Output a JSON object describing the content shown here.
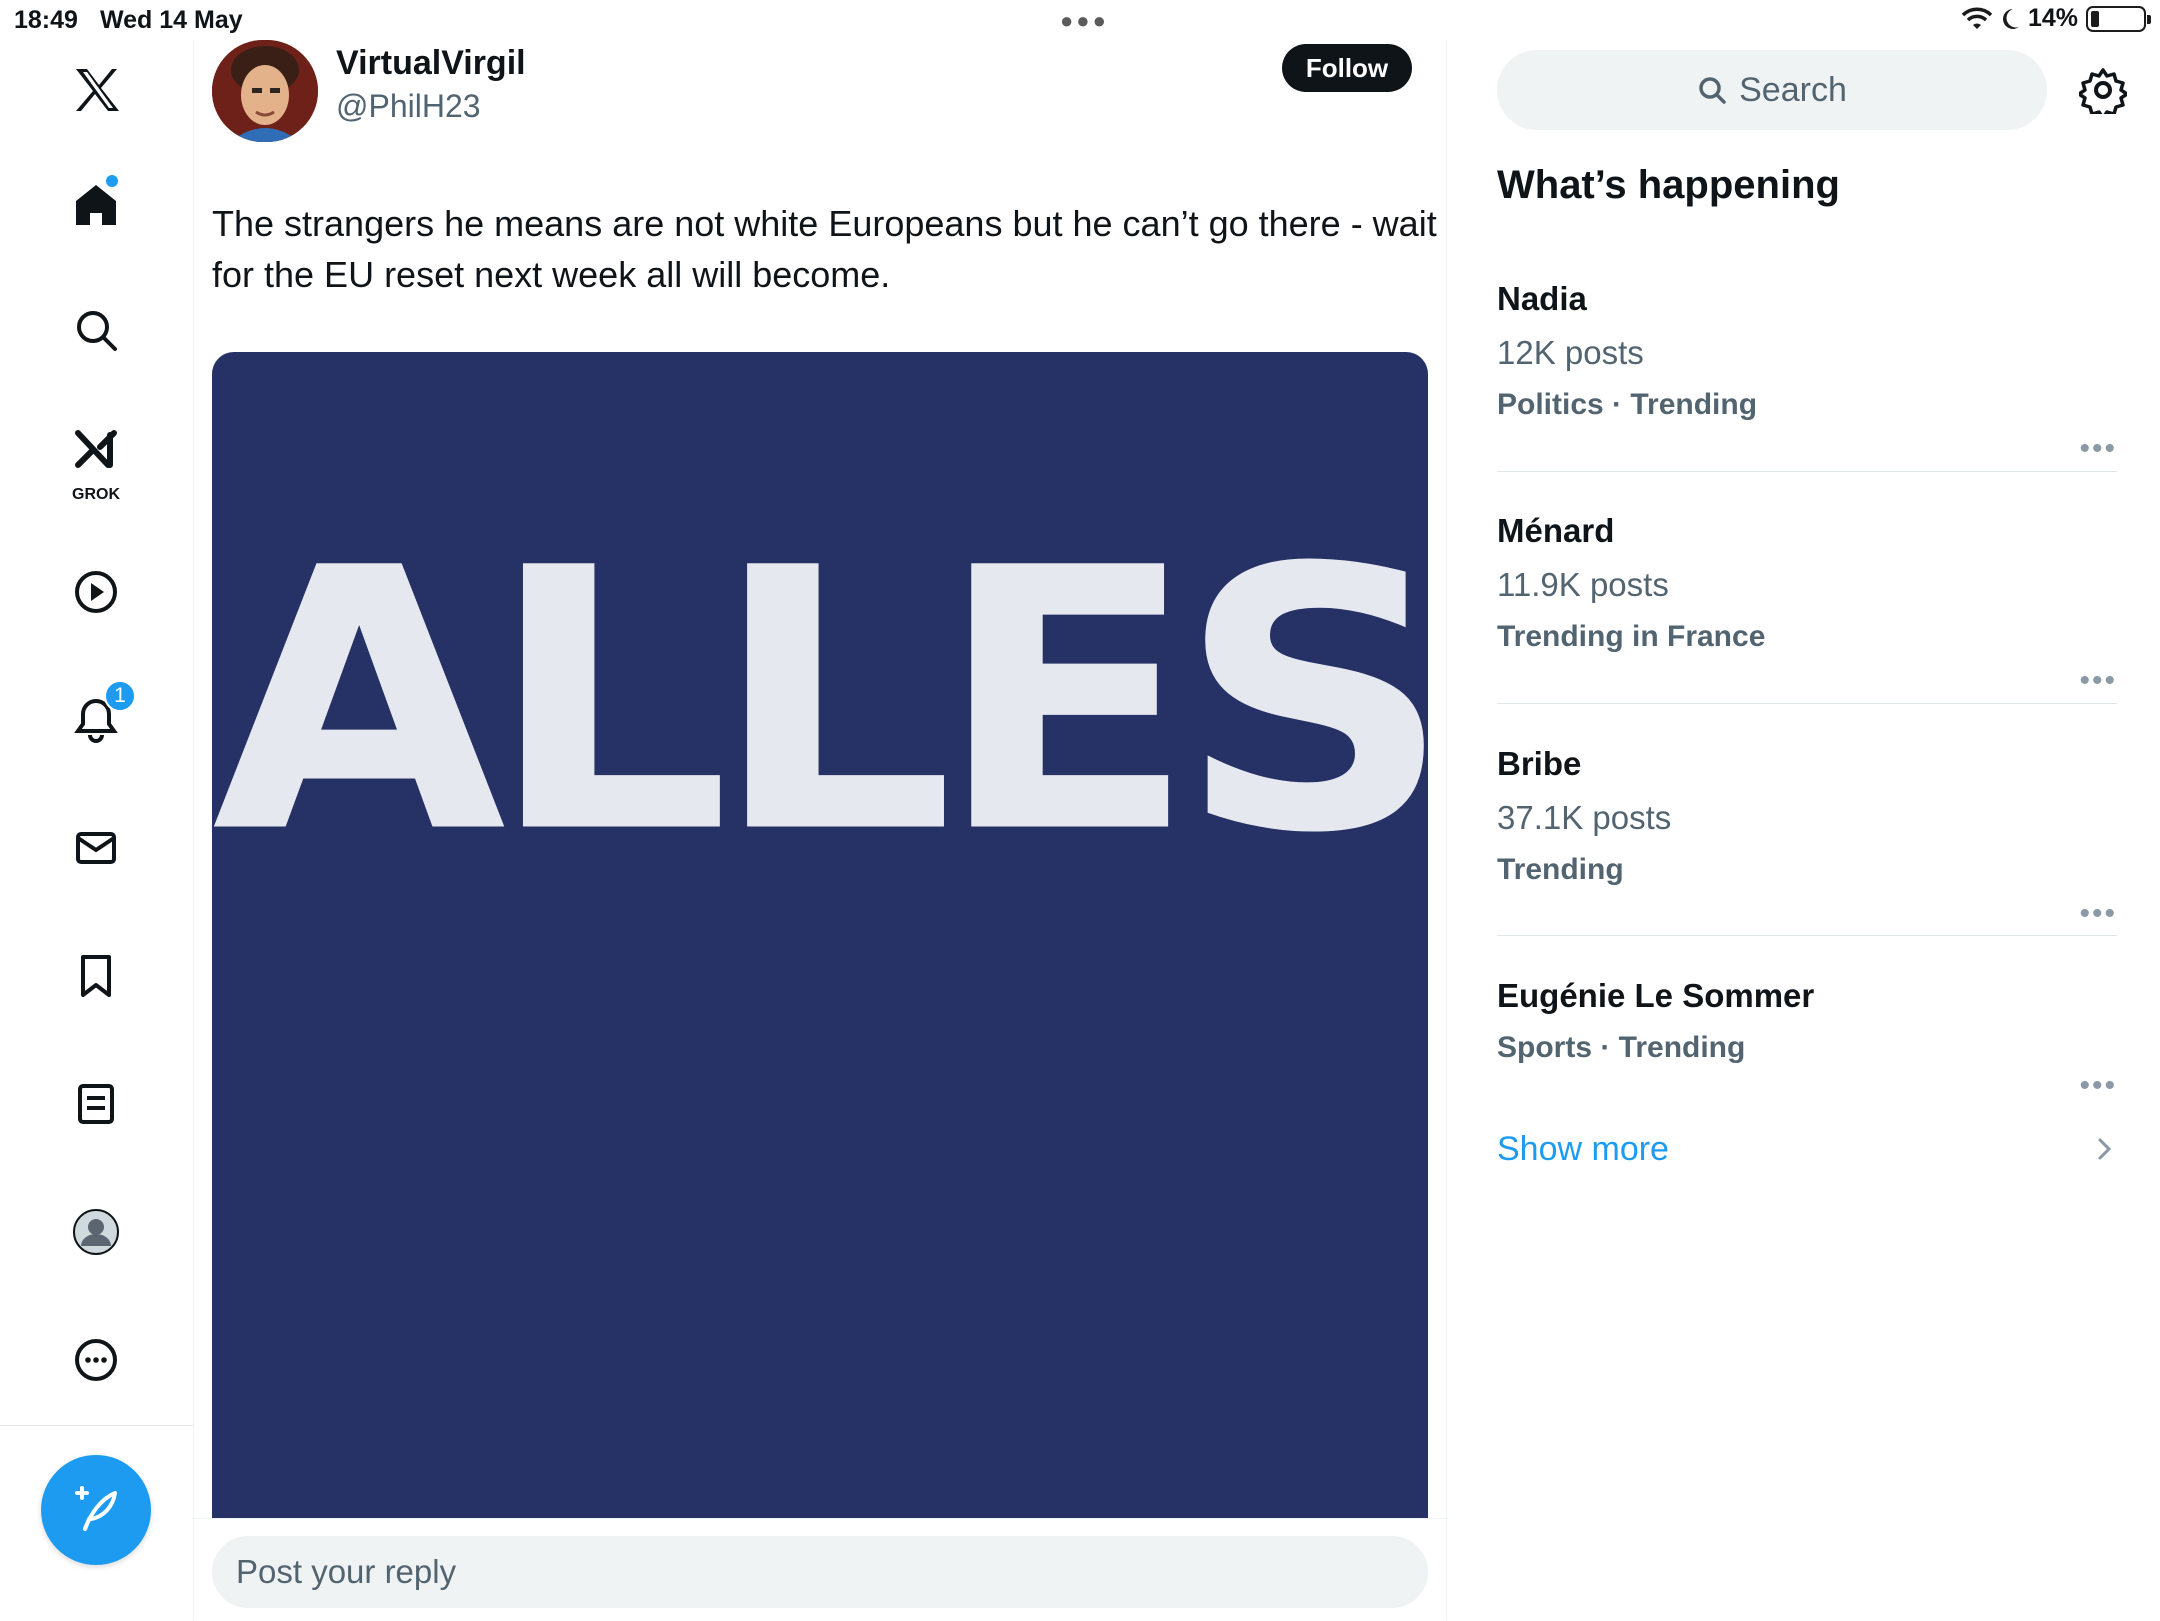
{
  "status_bar": {
    "time": "18:49",
    "date": "Wed 14 May",
    "battery": "14%"
  },
  "nav": {
    "items": [
      {
        "name": "home",
        "icon": "home-icon"
      },
      {
        "name": "explore",
        "icon": "search-icon"
      },
      {
        "name": "grok",
        "icon": "grok-icon",
        "label": "GROK"
      },
      {
        "name": "videos",
        "icon": "play-icon"
      },
      {
        "name": "notifications",
        "icon": "bell-icon",
        "badge": "1"
      },
      {
        "name": "messages",
        "icon": "mail-icon"
      },
      {
        "name": "bookmarks",
        "icon": "bookmark-icon"
      },
      {
        "name": "lists",
        "icon": "list-icon"
      },
      {
        "name": "profile",
        "icon": "profile-icon"
      },
      {
        "name": "more",
        "icon": "more-icon"
      }
    ],
    "compose_icon": "compose-icon"
  },
  "tweet": {
    "author_name": "VirtualVirgil",
    "author_handle": "@PhilH23",
    "follow_label": "Follow",
    "text": "The strangers he means are not white Europeans but he can’t go there - wait for the EU reset next week all will become.",
    "media_text": "ALLES",
    "media_bg": "#263265"
  },
  "reply": {
    "placeholder": "Post your reply"
  },
  "sidebar": {
    "search_label": "Search",
    "section_title": "What’s happening",
    "trends": [
      {
        "name": "Nadia",
        "count": "12K posts",
        "context": "Politics · Trending"
      },
      {
        "name": "Ménard",
        "count": "11.9K posts",
        "context": "Trending in France"
      },
      {
        "name": "Bribe",
        "count": "37.1K posts",
        "context": "Trending"
      },
      {
        "name": "Eugénie Le Sommer",
        "context": "Sports · Trending"
      }
    ],
    "show_more": "Show more"
  },
  "colors": {
    "accent": "#1d9bf0",
    "text_primary": "#0f1419",
    "text_secondary": "#536471"
  }
}
